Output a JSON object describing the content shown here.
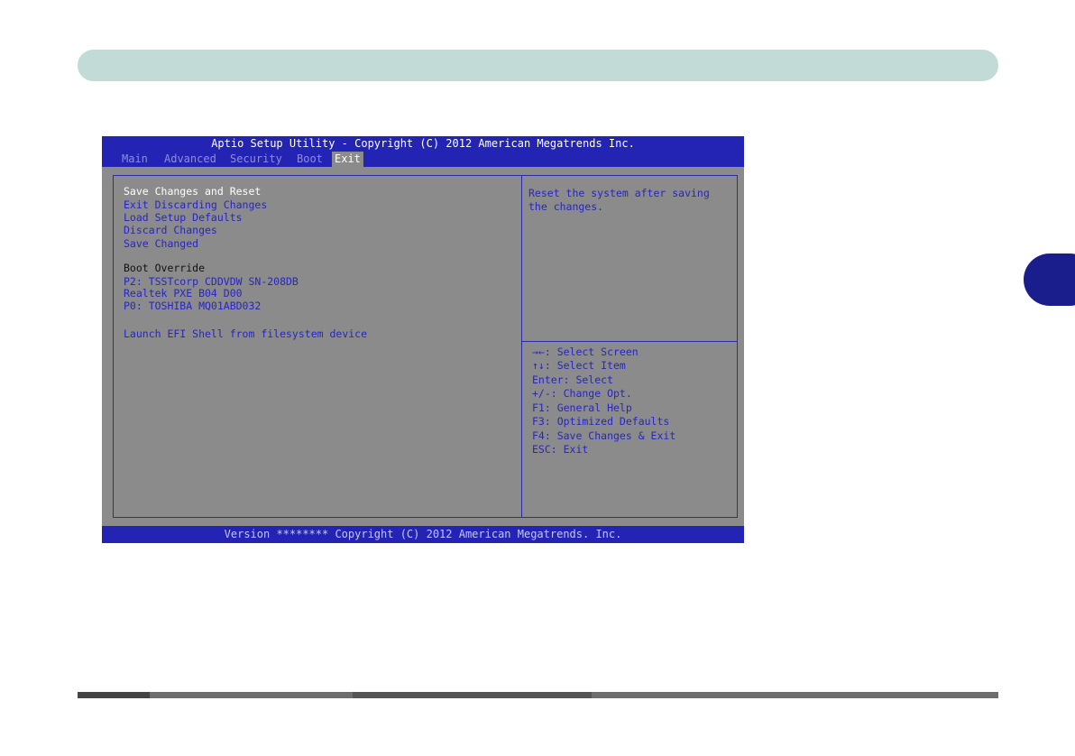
{
  "bios": {
    "title": "Aptio Setup Utility - Copyright (C) 2012 American Megatrends Inc.",
    "tabs": [
      "Main",
      "Advanced",
      "Security",
      "Boot",
      "Exit"
    ],
    "active_tab": "Exit",
    "menu": {
      "save_changes_reset": "Save Changes and Reset",
      "exit_discarding": "Exit Discarding Changes",
      "load_defaults": "Load Setup Defaults",
      "discard_changes": "Discard Changes",
      "save_changed": "Save Changed",
      "boot_override_heading": "Boot Override",
      "boot_devices": [
        "P2: TSSTcorp CDDVDW SN-208DB",
        "Realtek PXE B04 D00",
        "P0: TOSHIBA MQ01ABD032"
      ],
      "launch_efi": "Launch EFI Shell from filesystem device"
    },
    "help_text": [
      "Reset the system after saving",
      "the changes."
    ],
    "keys": [
      "→←: Select Screen",
      "↑↓: Select Item",
      "Enter: Select",
      "+/-: Change Opt.",
      "F1: General Help",
      "F3: Optimized Defaults",
      "F4: Save Changes & Exit",
      "ESC: Exit"
    ],
    "footer": "Version ******** Copyright (C) 2012 American Megatrends. Inc."
  },
  "colors": {
    "bios_blue": "#2424b4",
    "bios_gray": "#8b8b8b",
    "header_bar": "#c3dbd6",
    "chapter_tab": "#1a1d8c"
  }
}
